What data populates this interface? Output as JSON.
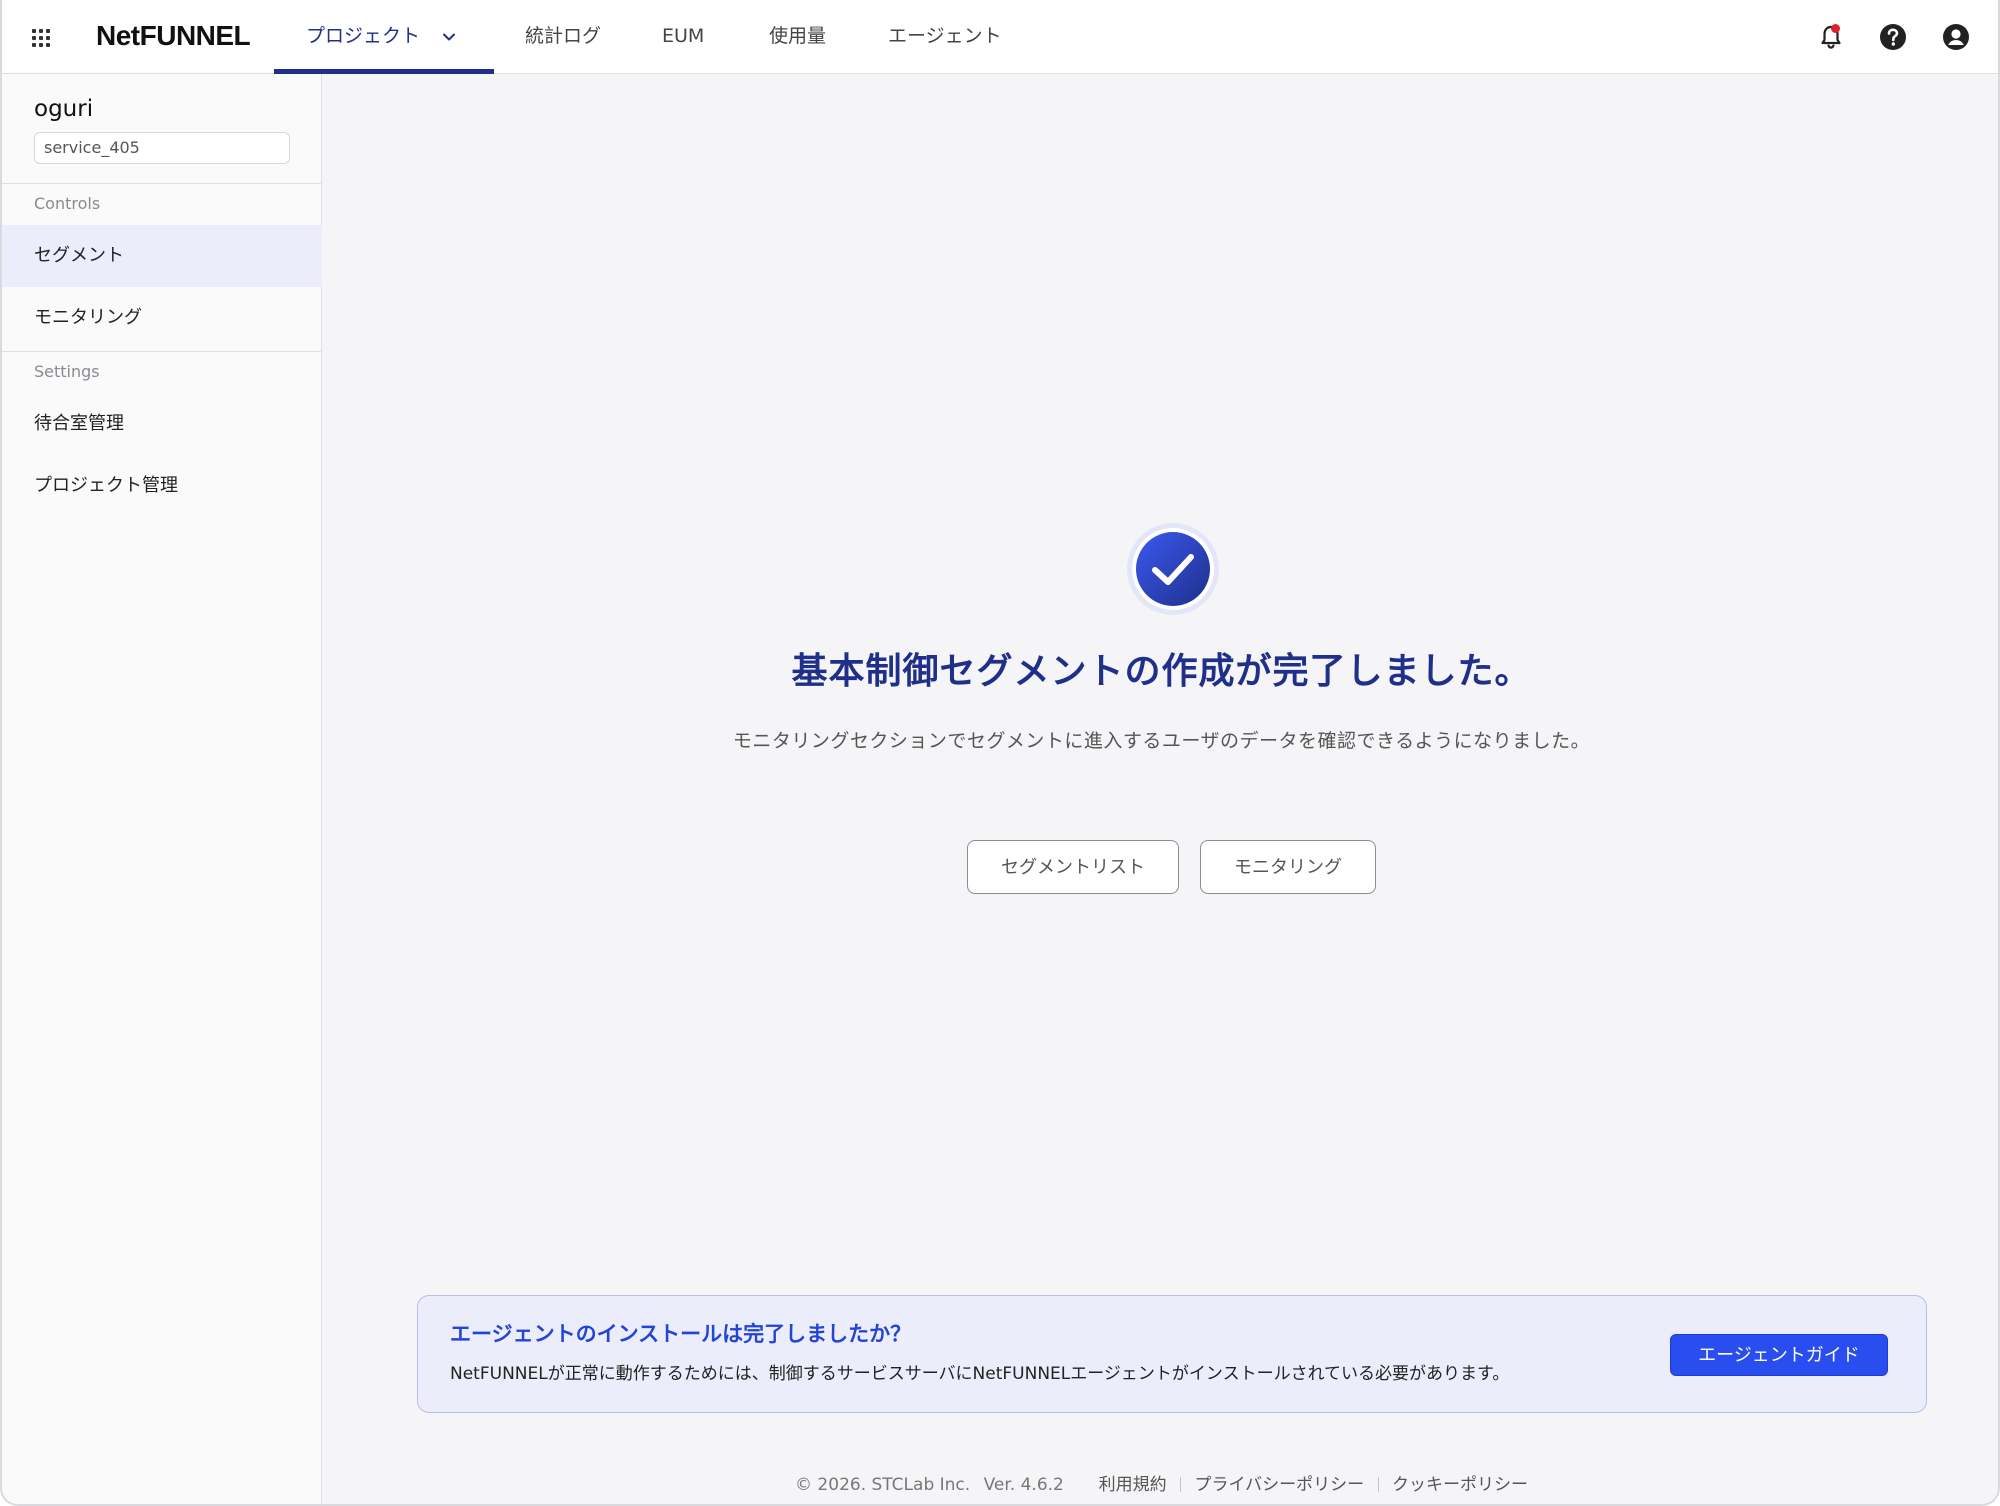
{
  "header": {
    "logo": "NetFUNNEL",
    "nav": {
      "project": "プロジェクト",
      "stats_log": "統計ログ",
      "eum": "EUM",
      "usage": "使用量",
      "agent": "エージェント"
    }
  },
  "sidebar": {
    "project_name": "oguri",
    "service_id": "service_405",
    "controls_title": "Controls",
    "settings_title": "Settings",
    "items": {
      "segment": "セグメント",
      "monitoring": "モニタリング",
      "waiting_room": "待合室管理",
      "project_management": "プロジェクト管理"
    }
  },
  "main": {
    "title": "基本制御セグメントの作成が完了しました。",
    "description": "モニタリングセクションでセグメントに進入するユーザのデータを確認できるようになりました。",
    "segment_list_button": "セグメントリスト",
    "monitoring_button": "モニタリング"
  },
  "banner": {
    "title": "エージェントのインストールは完了しましたか？",
    "description": "NetFUNNELが正常に動作するためには、制御するサービスサーバにNetFUNNELエージェントがインストールされている必要があります。",
    "button": "エージェントガイド"
  },
  "footer": {
    "copyright": "© 2026. STCLab Inc.",
    "version": "Ver. 4.6.2",
    "terms": "利用規約",
    "privacy": "プライバシーポリシー",
    "cookie": "クッキーポリシー"
  },
  "colors": {
    "brand": "#1f2f8a",
    "accent": "#2a4df0",
    "notification": "#e0212b"
  }
}
